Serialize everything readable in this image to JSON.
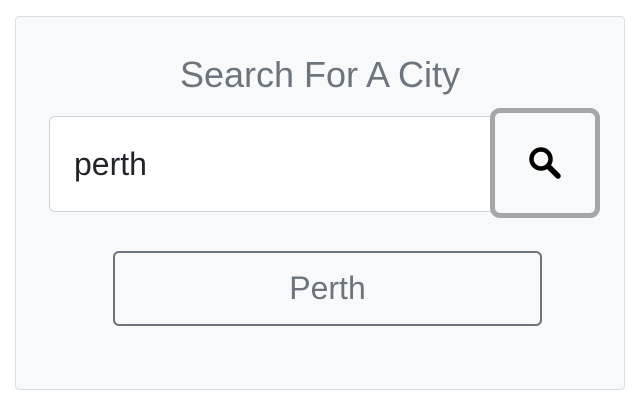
{
  "search": {
    "title": "Search For A City",
    "input_value": "perth",
    "button_icon": "search-icon"
  },
  "results": [
    {
      "label": "Perth"
    }
  ],
  "colors": {
    "title": "#6c757d",
    "card_background": "#f8f9fa",
    "button_outline": "#6c757d",
    "focus_ring": "#a4a7aa"
  }
}
